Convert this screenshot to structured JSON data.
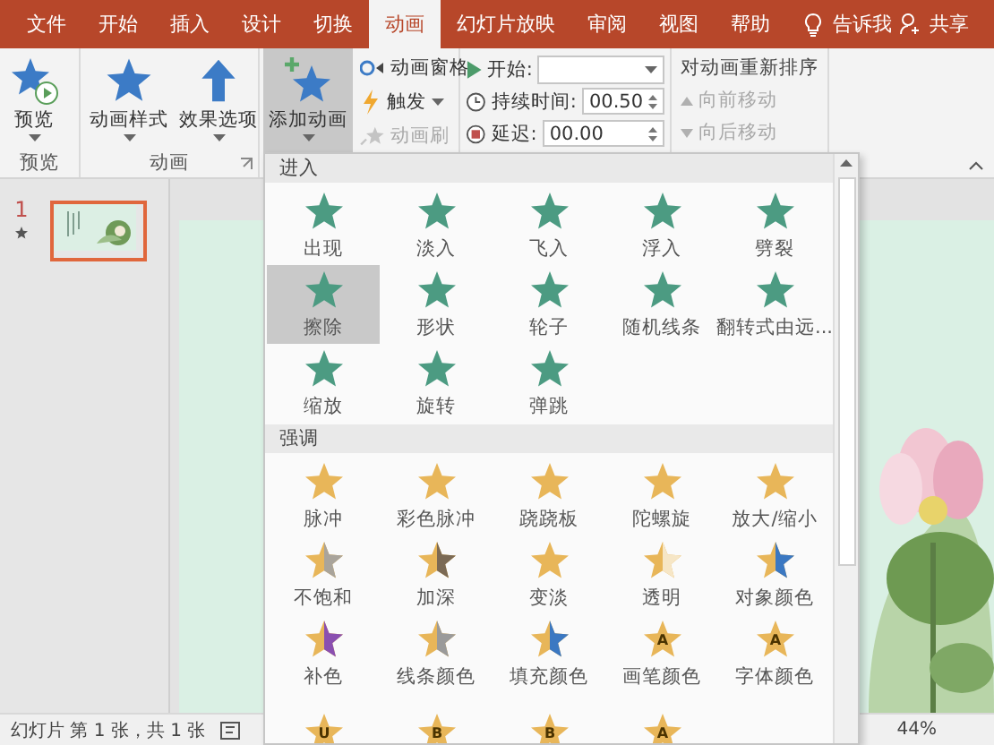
{
  "tabs": [
    {
      "label": "文件",
      "selected": false
    },
    {
      "label": "开始",
      "selected": false
    },
    {
      "label": "插入",
      "selected": false
    },
    {
      "label": "设计",
      "selected": false
    },
    {
      "label": "切换",
      "selected": false
    },
    {
      "label": "动画",
      "selected": true
    },
    {
      "label": "幻灯片放映",
      "selected": false
    },
    {
      "label": "审阅",
      "selected": false
    },
    {
      "label": "视图",
      "selected": false
    },
    {
      "label": "帮助",
      "selected": false
    }
  ],
  "tell_me": "告诉我",
  "share": "共享",
  "ribbon": {
    "preview": {
      "button": "预览",
      "group": "预览"
    },
    "animation": {
      "buttons": [
        "动画样式",
        "效果选项"
      ],
      "group": "动画"
    },
    "advanced": {
      "add_animation": "添加动画",
      "items": [
        {
          "label": "动画窗格",
          "disabled": false,
          "dropdown": false
        },
        {
          "label": "触发",
          "disabled": false,
          "dropdown": true
        },
        {
          "label": "动画刷",
          "disabled": true,
          "dropdown": false
        }
      ]
    },
    "timing": {
      "start_label": "开始:",
      "duration_label": "持续时间:",
      "duration": "00.50",
      "delay_label": "延迟:",
      "delay": "00.00"
    },
    "reorder": {
      "title": "对动画重新排序",
      "items": [
        {
          "label": "向前移动",
          "disabled": true
        },
        {
          "label": "向后移动",
          "disabled": true
        }
      ]
    }
  },
  "slides": [
    {
      "number": "1",
      "selected": true
    }
  ],
  "gallery": {
    "sections": [
      {
        "title": "进入",
        "kind": "entrance",
        "items": [
          {
            "label": "出现",
            "selected": false
          },
          {
            "label": "淡入",
            "selected": false
          },
          {
            "label": "飞入",
            "selected": false
          },
          {
            "label": "浮入",
            "selected": false
          },
          {
            "label": "劈裂",
            "selected": false
          },
          {
            "label": "擦除",
            "selected": true
          },
          {
            "label": "形状",
            "selected": false
          },
          {
            "label": "轮子",
            "selected": false
          },
          {
            "label": "随机线条",
            "selected": false
          },
          {
            "label": "翻转式由远...",
            "selected": false
          },
          {
            "label": "缩放",
            "selected": false
          },
          {
            "label": "旋转",
            "selected": false
          },
          {
            "label": "弹跳",
            "selected": false
          }
        ]
      },
      {
        "title": "强调",
        "kind": "emphasis",
        "items": [
          {
            "label": "脉冲",
            "selected": false
          },
          {
            "label": "彩色脉冲",
            "selected": false
          },
          {
            "label": "跷跷板",
            "selected": false
          },
          {
            "label": "陀螺旋",
            "selected": false
          },
          {
            "label": "放大/缩小",
            "selected": false
          },
          {
            "label": "不饱和",
            "selected": false,
            "color": "#a9a49b"
          },
          {
            "label": "加深",
            "selected": false,
            "color": "#7b6a55"
          },
          {
            "label": "变淡",
            "selected": false
          },
          {
            "label": "透明",
            "selected": false,
            "color": "#f6e6c6"
          },
          {
            "label": "对象颜色",
            "selected": false,
            "color": "#3b78c2"
          },
          {
            "label": "补色",
            "selected": false,
            "color": "#8a4fb0"
          },
          {
            "label": "线条颜色",
            "selected": false,
            "color": "#9a9a9a"
          },
          {
            "label": "填充颜色",
            "selected": false,
            "color": "#3b78c2"
          },
          {
            "label": "画笔颜色",
            "selected": false,
            "glyph": "A"
          },
          {
            "label": "字体颜色",
            "selected": false,
            "glyph": "A"
          },
          {
            "selected": false,
            "glyph": "U"
          },
          {
            "selected": false,
            "glyph": "B"
          },
          {
            "selected": false,
            "glyph": "B"
          },
          {
            "selected": false,
            "glyph": "A"
          }
        ]
      }
    ]
  },
  "status_bar": {
    "text": "幻灯片 第 1 张，共 1 张",
    "zoom": "44%"
  }
}
